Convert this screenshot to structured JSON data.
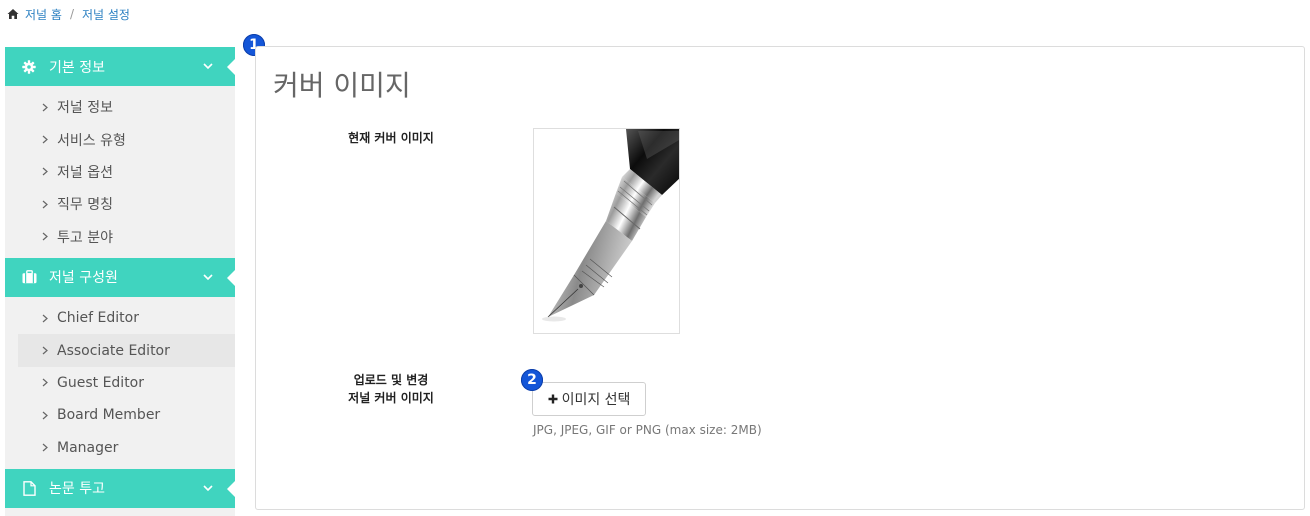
{
  "breadcrumb": {
    "home_icon": "home-icon",
    "items": [
      "저널 홈",
      "저널 설정"
    ],
    "separator": "/"
  },
  "colors": {
    "accent": "#40d4bf",
    "link": "#2a7fc1",
    "badge": "#1456d8",
    "sidebar_bg": "#f1f1f1"
  },
  "sidebar": {
    "sections": [
      {
        "title": "기본 정보",
        "icon": "gear-icon",
        "items": [
          "저널 정보",
          "서비스 유형",
          "저널 옵션",
          "직무 명칭",
          "투고 분야"
        ]
      },
      {
        "title": "저널 구성원",
        "icon": "briefcase-icon",
        "items": [
          "Chief Editor",
          "Associate Editor",
          "Guest Editor",
          "Board Member",
          "Manager"
        ]
      },
      {
        "title": "논문 투고",
        "icon": "document-icon",
        "items": []
      }
    ]
  },
  "badges": [
    "1",
    "2"
  ],
  "main": {
    "title": "커버 이미지",
    "current_label": "현재 커버 이미지",
    "upload_label_line1": "업로드 및 변경",
    "upload_label_line2": "저널 커버 이미지",
    "select_button": "이미지 선택",
    "hint": "JPG, JPEG, GIF or PNG (max size: 2MB)"
  }
}
